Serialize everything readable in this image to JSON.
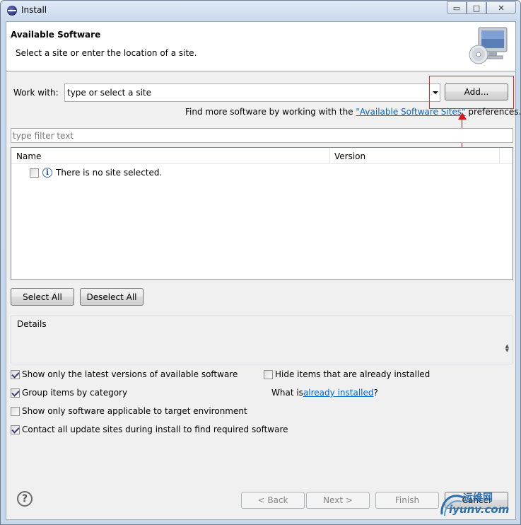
{
  "window": {
    "title": "Install",
    "controls": {
      "minimize": "▭",
      "maximize": "□",
      "close": "✕"
    }
  },
  "header": {
    "title": "Available Software",
    "description": "Select a site or enter the location of a site.",
    "icon": "monitor-cd-icon"
  },
  "work_with": {
    "label": "Work with:",
    "value": "type or select a site",
    "add_button": "Add...",
    "more_prefix": "Find more software by working with the ",
    "more_link": "\"Available Software Sites\"",
    "more_suffix": " preferences."
  },
  "filter": {
    "placeholder": "type filter text"
  },
  "tree": {
    "columns": [
      "Name",
      "Version"
    ],
    "rows": [
      {
        "checked": false,
        "icon": "info-icon",
        "text": "There is no site selected."
      }
    ]
  },
  "buttons": {
    "select_all": "Select All",
    "deselect_all": "Deselect All"
  },
  "details": {
    "label": "Details"
  },
  "options": {
    "latest_versions": {
      "label": "Show only the latest versions of available software",
      "checked": true
    },
    "hide_installed": {
      "label": "Hide items that are already installed",
      "checked": false
    },
    "group_by_category": {
      "label": "Group items by category",
      "checked": true
    },
    "what_is_prefix": "What is ",
    "what_is_link": "already installed",
    "what_is_suffix": "?",
    "target_env": {
      "label": "Show only software applicable to target environment",
      "checked": false
    },
    "contact_sites": {
      "label": "Contact all update sites during install to find required software",
      "checked": true
    }
  },
  "footer": {
    "back": "< Back",
    "next": "Next >",
    "finish": "Finish",
    "cancel": "Cancel"
  },
  "watermark": {
    "cn": "运维网",
    "en": "iyunv.com"
  },
  "colors": {
    "annotation_red": "#e2262a",
    "link": "#0066cc"
  }
}
